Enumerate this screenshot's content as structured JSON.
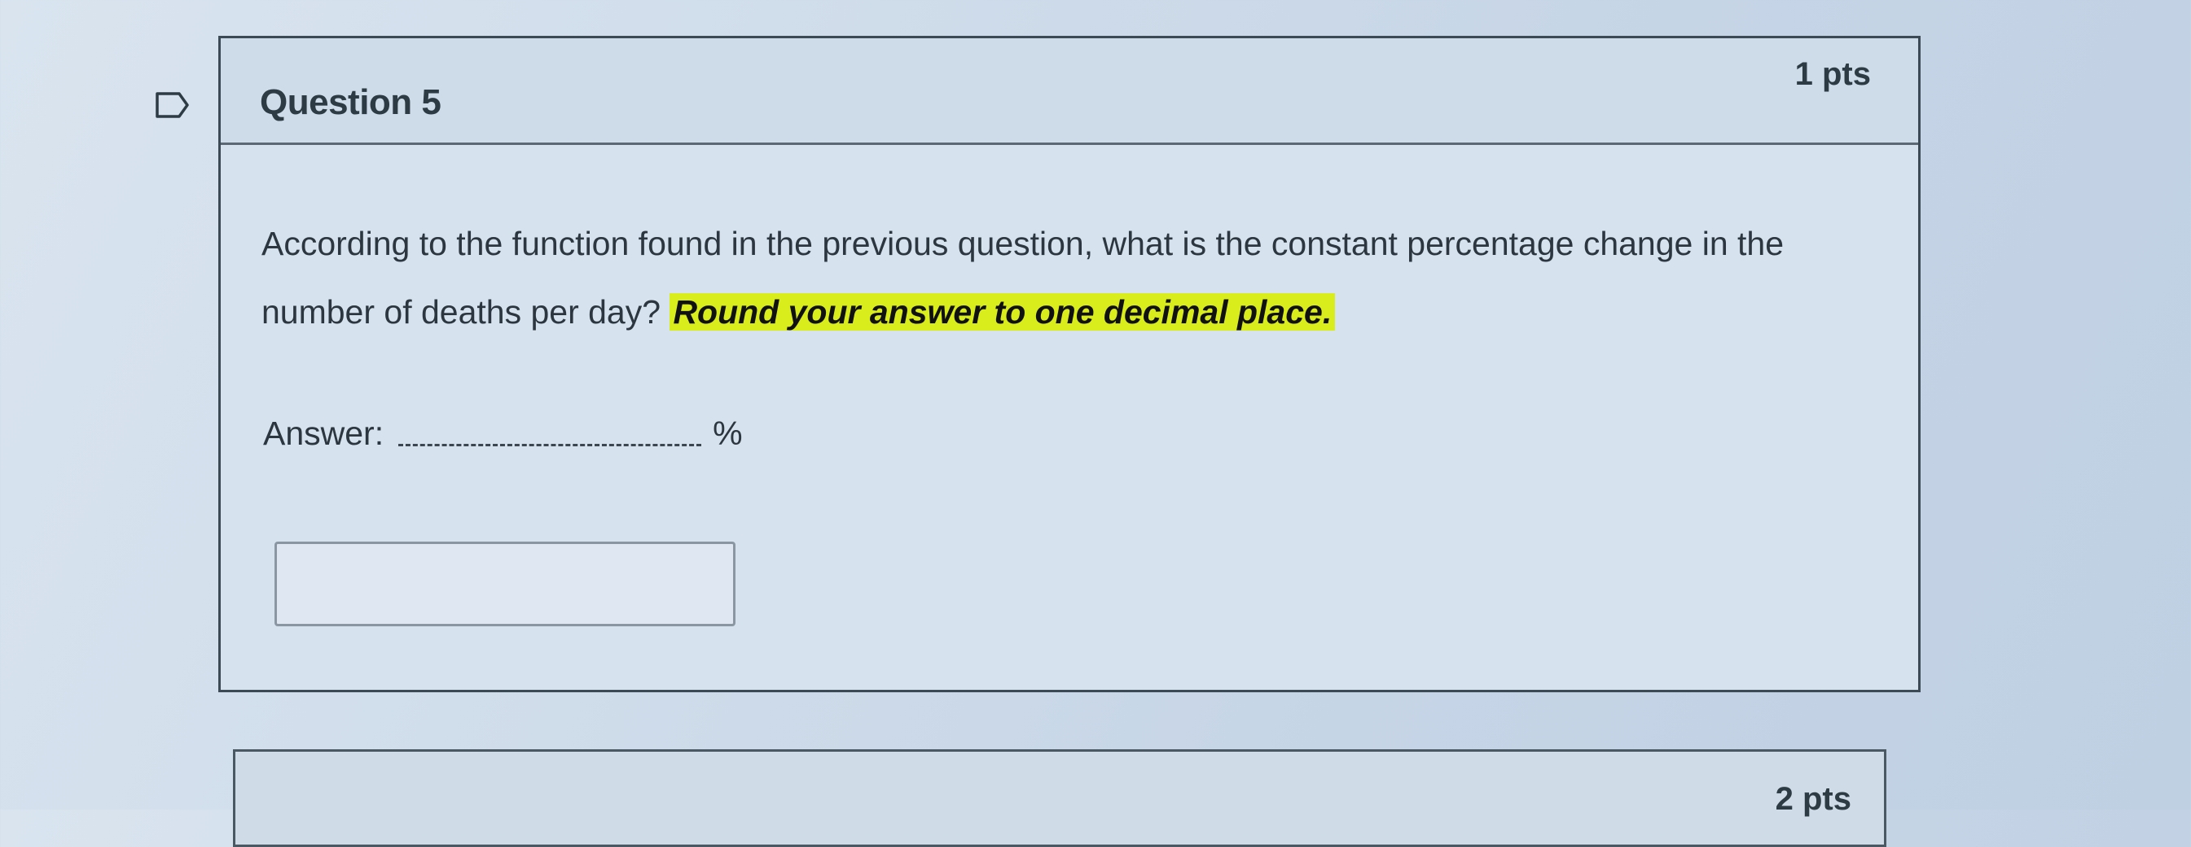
{
  "question": {
    "title": "Question 5",
    "points": "1 pts",
    "text_before": "According to the function found in the previous question, what is the constant percentage change in the number of deaths per day? ",
    "text_highlight": "Round your answer to one decimal place.",
    "answer_label": "Answer:",
    "answer_unit": "%",
    "answer_value": "",
    "flag_icon": "bookmark-flag-icon"
  },
  "next_question": {
    "points": "2 pts"
  },
  "colors": {
    "highlight": "#d9ec1c",
    "text": "#2d3b45",
    "border": "#3c4a56"
  }
}
